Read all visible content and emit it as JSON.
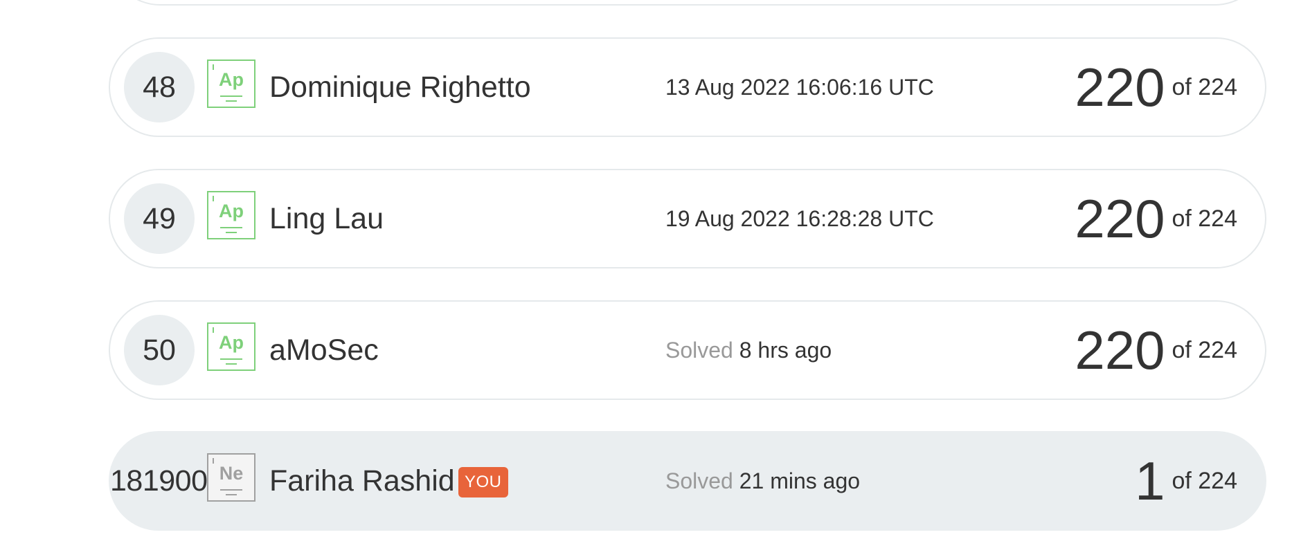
{
  "leaderboard": {
    "rows": [
      {
        "rank": "48",
        "badge": "Ap",
        "name": "Dominique Righetto",
        "solved_prefix": "",
        "solved_value": "13 Aug 2022 16:06:16 UTC",
        "score": "220",
        "of_total": "of 224"
      },
      {
        "rank": "49",
        "badge": "Ap",
        "name": "Ling Lau",
        "solved_prefix": "",
        "solved_value": "19 Aug 2022 16:28:28 UTC",
        "score": "220",
        "of_total": "of 224"
      },
      {
        "rank": "50",
        "badge": "Ap",
        "name": "aMoSec",
        "solved_prefix": "Solved",
        "solved_value": "8 hrs ago",
        "score": "220",
        "of_total": "of 224"
      }
    ],
    "current_user": {
      "rank": "181900",
      "badge": "Ne",
      "name": "Fariha Rashid",
      "you_label": "YOU",
      "solved_prefix": "Solved",
      "solved_value": "21 mins ago",
      "score": "1",
      "of_total": "of 224"
    }
  },
  "colors": {
    "badge_apprentice": "#7ed07a",
    "badge_neutral": "#a0a0a0",
    "you_tag": "#e8643a",
    "current_row_bg": "#eaeef0",
    "row_border": "#e5e9eb"
  }
}
